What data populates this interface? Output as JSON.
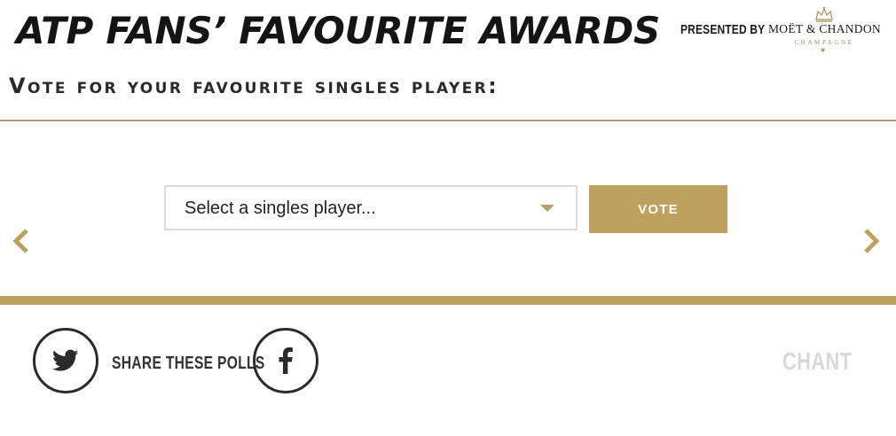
{
  "header": {
    "title": "ATP FANS’ FAVOURITE AWARDS",
    "presented_by": "PRESENTED BY",
    "sponsor": {
      "name": "MOËT & CHANDON",
      "sub": "CHAMPAGNE"
    }
  },
  "poll": {
    "heading": "Vote for your favourite singles player:",
    "select_placeholder": "Select a singles player...",
    "vote_label": "VOTE"
  },
  "share": {
    "label": "SHARE THESE POLLS",
    "brand": "CHANT"
  },
  "colors": {
    "accent_gold": "#bea15e",
    "rule_gold": "#b5a06a",
    "text_dark": "#1a1a1a",
    "muted_logo": "#d8d8d8"
  },
  "icons": {
    "prev": "chevron-left-icon",
    "next": "chevron-right-icon",
    "dropdown": "caret-down-icon",
    "twitter": "twitter-icon",
    "facebook": "facebook-icon",
    "sponsor_crown": "crown-icon"
  }
}
